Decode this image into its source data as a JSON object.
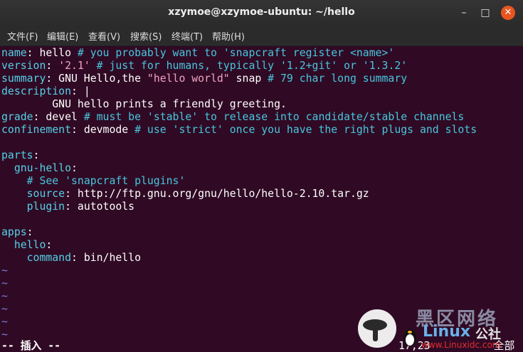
{
  "window": {
    "title": "xzymoe@xzymoe-ubuntu: ~/hello",
    "minimize_symbol": "–",
    "maximize_symbol": "□",
    "close_symbol": "✕"
  },
  "menu": [
    {
      "label": "文件(F)"
    },
    {
      "label": "编辑(E)"
    },
    {
      "label": "查看(V)"
    },
    {
      "label": "搜索(S)"
    },
    {
      "label": "终端(T)"
    },
    {
      "label": "帮助(H)"
    }
  ],
  "editor": {
    "lines": [
      [
        {
          "t": "name",
          "c": "k"
        },
        {
          "t": ": hello ",
          "c": ""
        },
        {
          "t": "# you probably want to 'snapcraft register <name>'",
          "c": "c"
        }
      ],
      [
        {
          "t": "version",
          "c": "k"
        },
        {
          "t": ": ",
          "c": ""
        },
        {
          "t": "'2.1'",
          "c": "s"
        },
        {
          "t": " ",
          "c": ""
        },
        {
          "t": "# just for humans, typically '1.2+git' or '1.3.2'",
          "c": "c"
        }
      ],
      [
        {
          "t": "summary",
          "c": "k"
        },
        {
          "t": ": GNU Hello,the ",
          "c": ""
        },
        {
          "t": "\"hello world\"",
          "c": "s"
        },
        {
          "t": " snap ",
          "c": ""
        },
        {
          "t": "# 79 char long summary",
          "c": "c"
        }
      ],
      [
        {
          "t": "description",
          "c": "k"
        },
        {
          "t": ": |",
          "c": ""
        }
      ],
      [
        {
          "t": "        GNU hello prints a friendly greeting.",
          "c": ""
        }
      ],
      [
        {
          "t": "grade",
          "c": "k"
        },
        {
          "t": ": devel ",
          "c": ""
        },
        {
          "t": "# must be 'stable' to release into candidate/stable channels",
          "c": "c"
        }
      ],
      [
        {
          "t": "confinement",
          "c": "k"
        },
        {
          "t": ": devmode ",
          "c": ""
        },
        {
          "t": "# use 'strict' once you have the right plugs and slots",
          "c": "c"
        }
      ],
      [],
      [
        {
          "t": "parts",
          "c": "k"
        },
        {
          "t": ":",
          "c": ""
        }
      ],
      [
        {
          "t": "  ",
          "c": ""
        },
        {
          "t": "gnu-hello",
          "c": "k"
        },
        {
          "t": ":",
          "c": ""
        }
      ],
      [
        {
          "t": "    ",
          "c": ""
        },
        {
          "t": "# See 'snapcraft plugins'",
          "c": "c"
        }
      ],
      [
        {
          "t": "    ",
          "c": ""
        },
        {
          "t": "source",
          "c": "k"
        },
        {
          "t": ": http://ftp.gnu.org/gnu/hello/hello-2.10.tar.gz",
          "c": ""
        }
      ],
      [
        {
          "t": "    ",
          "c": ""
        },
        {
          "t": "plugin",
          "c": "k"
        },
        {
          "t": ": autotools",
          "c": ""
        }
      ],
      [],
      [
        {
          "t": "apps",
          "c": "k"
        },
        {
          "t": ":",
          "c": ""
        }
      ],
      [
        {
          "t": "  ",
          "c": ""
        },
        {
          "t": "hello",
          "c": "k"
        },
        {
          "t": ":",
          "c": ""
        }
      ],
      [
        {
          "t": "    ",
          "c": ""
        },
        {
          "t": "command",
          "c": "k"
        },
        {
          "t": ": bin/hello",
          "c": ""
        }
      ],
      [
        {
          "t": "~",
          "c": "t"
        }
      ],
      [
        {
          "t": "~",
          "c": "t"
        }
      ],
      [
        {
          "t": "~",
          "c": "t"
        }
      ],
      [
        {
          "t": "~",
          "c": "t"
        }
      ],
      [
        {
          "t": "~",
          "c": "t"
        }
      ],
      [
        {
          "t": "~",
          "c": "t"
        }
      ]
    ],
    "mode": "-- 插入 --",
    "position": "17,23",
    "scroll": "全部"
  },
  "watermark": {
    "brand_cn": "黑区网络",
    "brand_en": "Linux",
    "brand_suffix": "公社",
    "site": "www.Linuxidc.com"
  },
  "colors": {
    "background": "#300a24",
    "keyword": "#55d0e8",
    "comment": "#48c6de",
    "string": "#f2a2c2",
    "tilde": "#7c7ce8",
    "close_button": "#e9541f"
  }
}
